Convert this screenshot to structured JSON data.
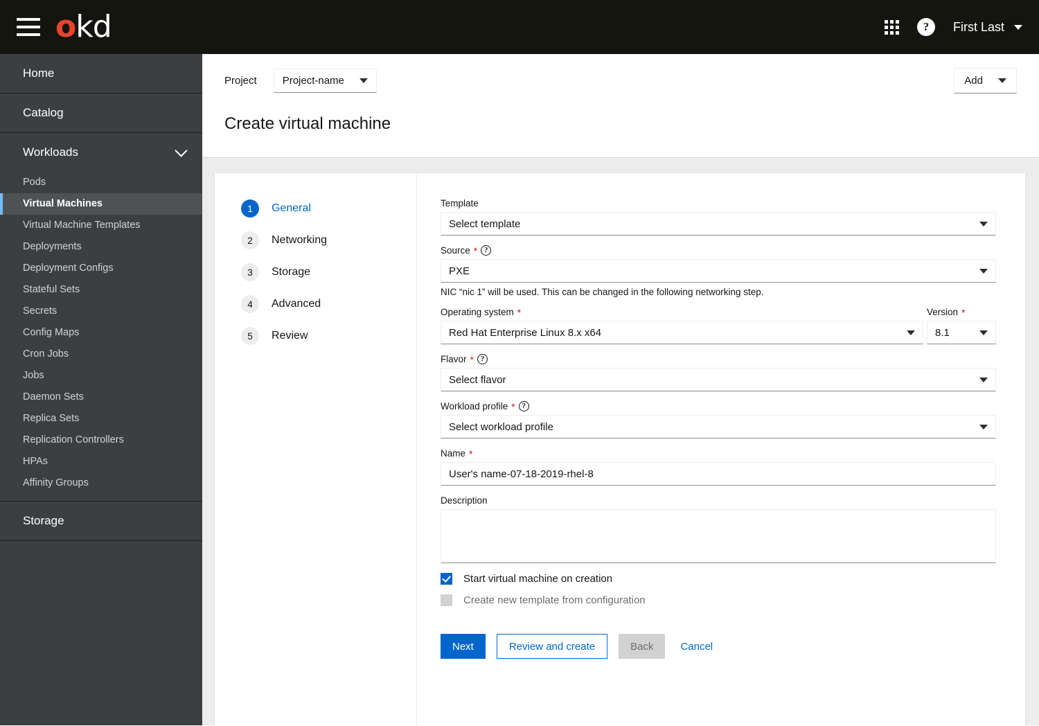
{
  "masthead": {
    "menu_icon": "hamburger-icon",
    "brand_first": "o",
    "brand_rest": "kd",
    "apps_icon": "grid-apps-icon",
    "help_icon": "?",
    "user_name": "First Last"
  },
  "sidebar": {
    "top_items": [
      {
        "label": "Home"
      },
      {
        "label": "Catalog"
      }
    ],
    "group": {
      "label": "Workloads",
      "expanded": true,
      "items": [
        {
          "label": "Pods",
          "active": false
        },
        {
          "label": "Virtual Machines",
          "active": true
        },
        {
          "label": "Virtual Machine Templates",
          "active": false
        },
        {
          "label": "Deployments",
          "active": false
        },
        {
          "label": "Deployment Configs",
          "active": false
        },
        {
          "label": "Stateful Sets",
          "active": false
        },
        {
          "label": "Secrets",
          "active": false
        },
        {
          "label": "Config Maps",
          "active": false
        },
        {
          "label": "Cron Jobs",
          "active": false
        },
        {
          "label": "Jobs",
          "active": false
        },
        {
          "label": "Daemon Sets",
          "active": false
        },
        {
          "label": "Replica Sets",
          "active": false
        },
        {
          "label": "Replication Controllers",
          "active": false
        },
        {
          "label": "HPAs",
          "active": false
        },
        {
          "label": "Affinity Groups",
          "active": false
        }
      ]
    },
    "bottom_items": [
      {
        "label": "Storage"
      }
    ]
  },
  "page": {
    "project_label": "Project",
    "project_value": "Project-name",
    "add_label": "Add",
    "title": "Create virtual machine"
  },
  "wizard": {
    "steps": [
      {
        "num": "1",
        "label": "General",
        "active": true
      },
      {
        "num": "2",
        "label": "Networking",
        "active": false
      },
      {
        "num": "3",
        "label": "Storage",
        "active": false
      },
      {
        "num": "4",
        "label": "Advanced",
        "active": false
      },
      {
        "num": "5",
        "label": "Review",
        "active": false
      }
    ],
    "form": {
      "template_label": "Template",
      "template_value": "Select template",
      "source_label": "Source",
      "source_value": "PXE",
      "source_helper": "NIC “nic 1” will be used. This can be changed in the following networking step.",
      "os_label": "Operating system",
      "os_value": "Red Hat Enterprise Linux 8.x x64",
      "version_label": "Version",
      "version_value": "8.1",
      "flavor_label": "Flavor",
      "flavor_value": "Select flavor",
      "workload_label": "Workload profile",
      "workload_value": "Select workload profile",
      "name_label": "Name",
      "name_value": "User's name-07-18-2019-rhel-8",
      "description_label": "Description",
      "description_value": "",
      "description_placeholder": "",
      "checkbox_start_label": "Start virtual machine on creation",
      "checkbox_template_label": "Create new template from configuration",
      "required_marker": "*",
      "hint_glyph": "?"
    },
    "buttons": {
      "next": "Next",
      "review": "Review and create",
      "back": "Back",
      "cancel": "Cancel"
    }
  },
  "colors": {
    "masthead_bg": "#151510",
    "brand_red": "#e8442c",
    "sidebar_bg": "#3c3f42",
    "sidebar_active_bg": "#4f5255",
    "sidebar_active_bar": "#73bcf7",
    "accent_blue": "#0066cc",
    "required_red": "#c9190b",
    "page_bg": "#ededed"
  }
}
